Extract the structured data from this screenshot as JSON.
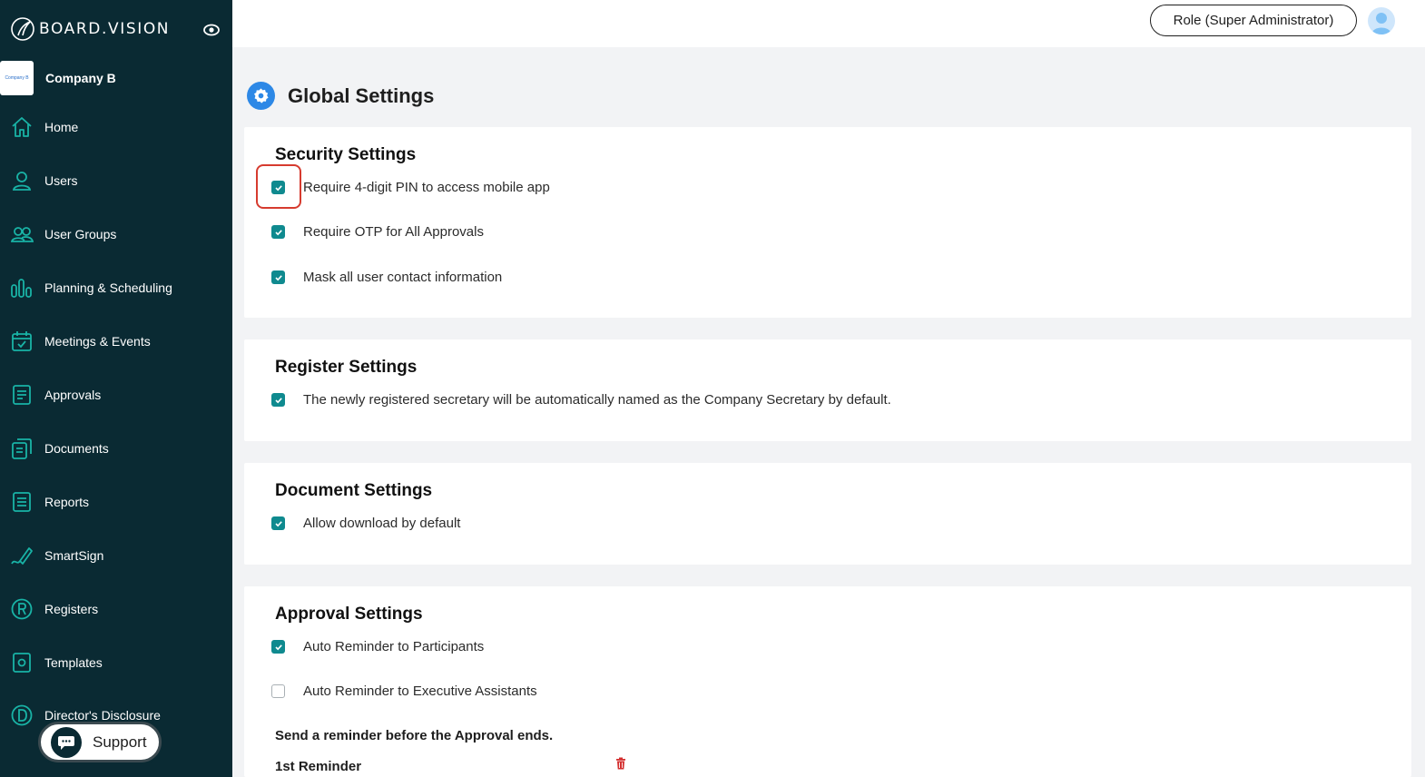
{
  "brand": {
    "name": "BOARD.VISION"
  },
  "company": {
    "logo_text": "Company B",
    "name": "Company B"
  },
  "sidebar": {
    "items": [
      {
        "label": "Home",
        "icon": "home-icon"
      },
      {
        "label": "Users",
        "icon": "user-icon"
      },
      {
        "label": "User Groups",
        "icon": "users-icon"
      },
      {
        "label": "Planning & Scheduling",
        "icon": "bars-icon"
      },
      {
        "label": "Meetings & Events",
        "icon": "calendar-icon"
      },
      {
        "label": "Approvals",
        "icon": "approval-doc-icon"
      },
      {
        "label": "Documents",
        "icon": "documents-icon"
      },
      {
        "label": "Reports",
        "icon": "report-list-icon"
      },
      {
        "label": "SmartSign",
        "icon": "pen-signature-icon"
      },
      {
        "label": "Registers",
        "icon": "registered-circle-icon"
      },
      {
        "label": "Templates",
        "icon": "template-icon"
      },
      {
        "label": "Director's Disclosure",
        "icon": "d-circle-icon"
      }
    ],
    "support_label": "Support"
  },
  "topbar": {
    "role_label": "Role (Super Administrator)"
  },
  "page": {
    "title": "Global Settings"
  },
  "security": {
    "title": "Security Settings",
    "options": [
      {
        "label": "Require 4-digit PIN to access mobile app",
        "checked": true
      },
      {
        "label": "Require OTP for All Approvals",
        "checked": true
      },
      {
        "label": "Mask all user contact information",
        "checked": true
      }
    ]
  },
  "register": {
    "title": "Register Settings",
    "options": [
      {
        "label": "The newly registered secretary will be automatically named as the Company Secretary by default.",
        "checked": true
      }
    ]
  },
  "document": {
    "title": "Document Settings",
    "options": [
      {
        "label": "Allow download by default",
        "checked": true
      }
    ]
  },
  "approval": {
    "title": "Approval Settings",
    "options": [
      {
        "label": "Auto Reminder to Participants",
        "checked": true
      },
      {
        "label": "Auto Reminder to Executive Assistants",
        "checked": false
      }
    ],
    "reminder_heading": "Send a reminder before the Approval ends.",
    "first_reminder_label": "1st Reminder"
  },
  "colors": {
    "sidebar": "#0a2a33",
    "accent": "#0f8a8f",
    "gear": "#2d88e6",
    "highlight": "#d63b2f",
    "trash": "#d32f2f"
  }
}
